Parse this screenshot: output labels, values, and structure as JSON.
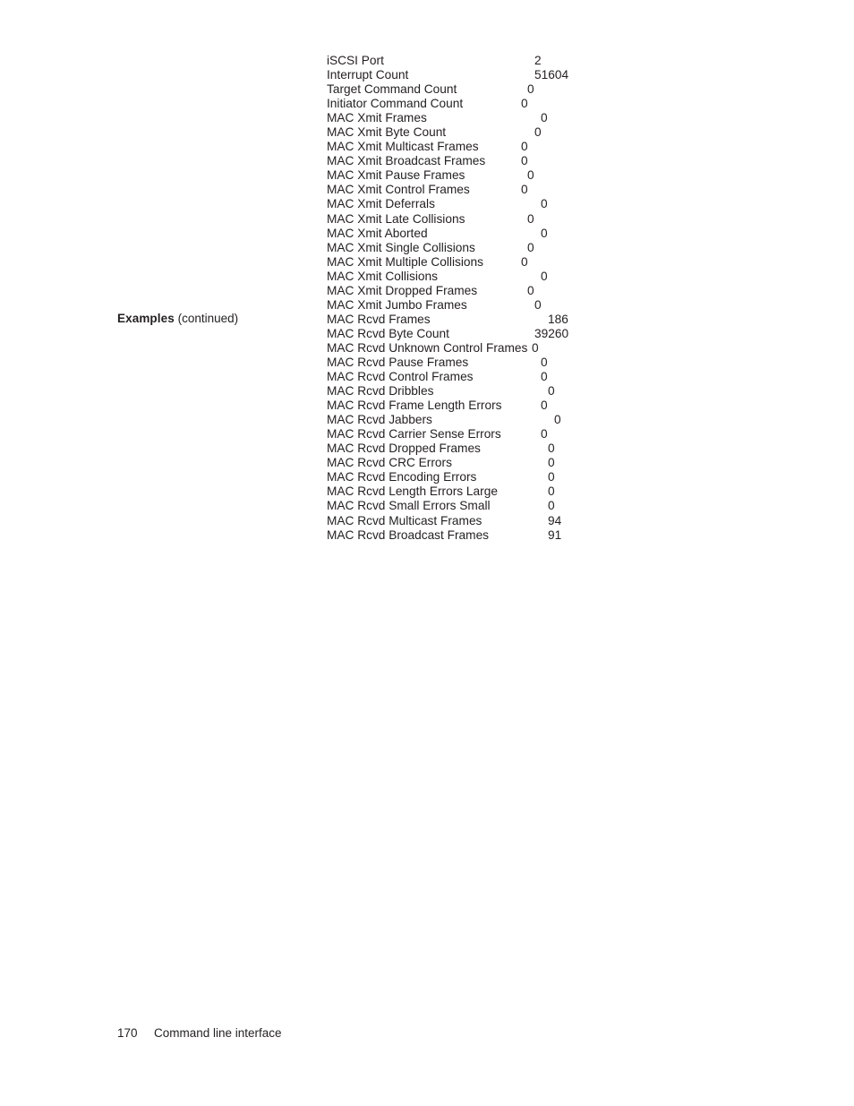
{
  "page": {
    "background": "#ffffff",
    "text_color": "#231f20"
  },
  "side_heading": {
    "strong": "Examples",
    "regular": " (continued)"
  },
  "listing": {
    "rows": [
      {
        "label": "iSCSI Port",
        "value": "2",
        "value_x": 232
      },
      {
        "label": "Interrupt Count",
        "value": "51604",
        "value_x": 232
      },
      {
        "label": "Target Command Count",
        "value": "0",
        "value_x": 224
      },
      {
        "label": "Initiator Command Count",
        "value": "0",
        "value_x": 217
      },
      {
        "label": "MAC Xmit Frames",
        "value": "0",
        "value_x": 239
      },
      {
        "label": "MAC Xmit Byte Count",
        "value": "0",
        "value_x": 232
      },
      {
        "label": "MAC Xmit Multicast Frames",
        "value": "0",
        "value_x": 217
      },
      {
        "label": "MAC Xmit Broadcast Frames",
        "value": "0",
        "value_x": 217
      },
      {
        "label": "MAC Xmit Pause Frames",
        "value": "0",
        "value_x": 224
      },
      {
        "label": "MAC Xmit Control Frames",
        "value": "0",
        "value_x": 217
      },
      {
        "label": "MAC Xmit Deferrals",
        "value": "0",
        "value_x": 239
      },
      {
        "label": "MAC Xmit Late Collisions",
        "value": "0",
        "value_x": 224
      },
      {
        "label": "MAC Xmit Aborted",
        "value": "0",
        "value_x": 239
      },
      {
        "label": "MAC Xmit Single Collisions",
        "value": "0",
        "value_x": 224
      },
      {
        "label": "MAC Xmit Multiple Collisions",
        "value": "0",
        "value_x": 217
      },
      {
        "label": "MAC Xmit Collisions",
        "value": "0",
        "value_x": 239
      },
      {
        "label": "MAC Xmit Dropped Frames",
        "value": "0",
        "value_x": 224
      },
      {
        "label": "MAC Xmit Jumbo Frames",
        "value": "0",
        "value_x": 232
      },
      {
        "label": "MAC Rcvd Frames",
        "value": "186",
        "value_x": 247
      },
      {
        "label": "MAC Rcvd Byte Count",
        "value": "39260",
        "value_x": 232
      },
      {
        "label": "MAC Rcvd Unknown Control Frames",
        "value": "0",
        "value_x": 229
      },
      {
        "label": "MAC Rcvd Pause Frames",
        "value": "0",
        "value_x": 239
      },
      {
        "label": "MAC Rcvd Control Frames",
        "value": "0",
        "value_x": 239
      },
      {
        "label": "MAC Rcvd Dribbles",
        "value": "0",
        "value_x": 247
      },
      {
        "label": "MAC Rcvd Frame Length Errors",
        "value": "0",
        "value_x": 239
      },
      {
        "label": "MAC Rcvd Jabbers",
        "value": "0",
        "value_x": 254
      },
      {
        "label": "MAC Rcvd Carrier Sense Errors",
        "value": "0",
        "value_x": 239
      },
      {
        "label": "MAC Rcvd Dropped Frames",
        "value": "0",
        "value_x": 247
      },
      {
        "label": "MAC Rcvd CRC Errors",
        "value": "0",
        "value_x": 247
      },
      {
        "label": "MAC Rcvd Encoding Errors",
        "value": "0",
        "value_x": 247
      },
      {
        "label": "MAC Rcvd Length Errors Large",
        "value": "0",
        "value_x": 247
      },
      {
        "label": "MAC Rcvd Small Errors Small",
        "value": "0",
        "value_x": 247
      },
      {
        "label": "MAC Rcvd Multicast Frames",
        "value": "94",
        "value_x": 247
      },
      {
        "label": "MAC Rcvd Broadcast Frames",
        "value": "91",
        "value_x": 247
      }
    ]
  },
  "footer": {
    "page_number": "170",
    "chapter": "Command line interface"
  }
}
